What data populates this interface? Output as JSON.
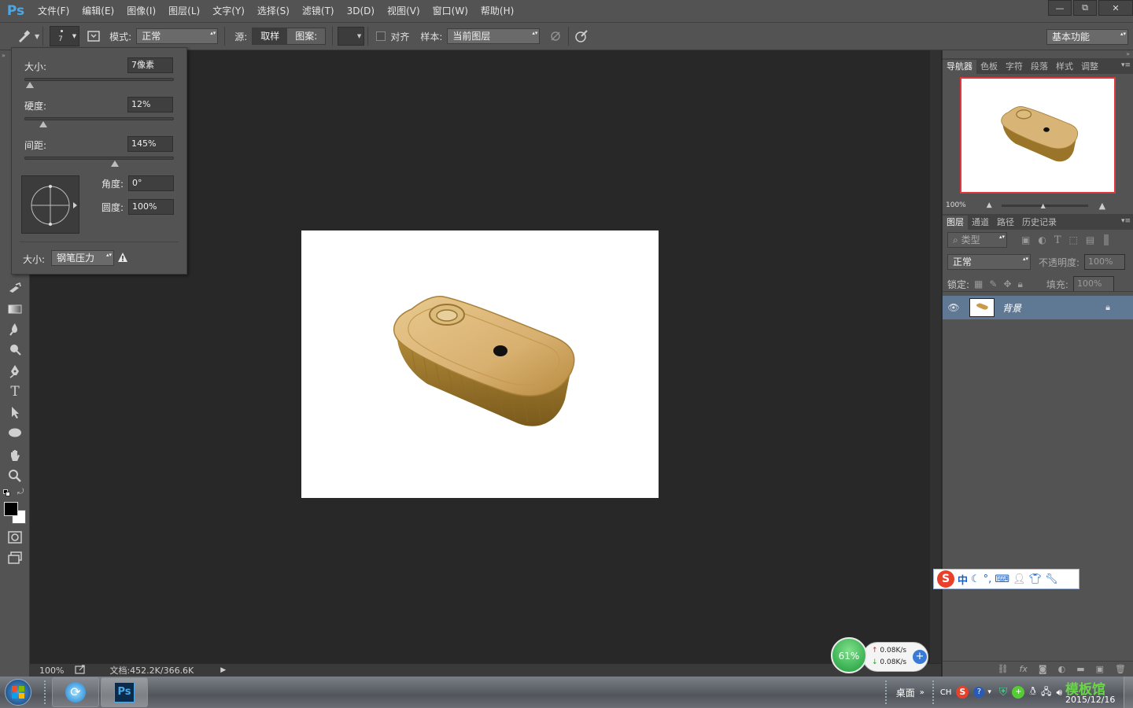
{
  "app": {
    "logo": "Ps"
  },
  "menu": [
    "文件(F)",
    "编辑(E)",
    "图像(I)",
    "图层(L)",
    "文字(Y)",
    "选择(S)",
    "滤镜(T)",
    "3D(D)",
    "视图(V)",
    "窗口(W)",
    "帮助(H)"
  ],
  "window_controls": {
    "minimize": "—",
    "restore": "⧉",
    "close": "✕"
  },
  "options": {
    "brush_size": "7",
    "mode_label": "模式:",
    "mode_value": "正常",
    "source_label": "源:",
    "source_sampled": "取样",
    "source_pattern": "图案:",
    "aligned_label": "对齐",
    "sample_label": "样本:",
    "sample_value": "当前图层",
    "workspace": "基本功能"
  },
  "brush_popup": {
    "size_label": "大小:",
    "size_value": "7像素",
    "hardness_label": "硬度:",
    "hardness_value": "12%",
    "spacing_label": "间距:",
    "spacing_value": "145%",
    "angle_label": "角度:",
    "angle_value": "0°",
    "roundness_label": "圆度:",
    "roundness_value": "100%",
    "pressure_label": "大小:",
    "pressure_value": "钢笔压力",
    "size_level": 0.03,
    "hardness_level": 0.12,
    "spacing_level": 0.6
  },
  "status": {
    "zoom": "100%",
    "doc": "文档:452.2K/366.6K"
  },
  "navigator": {
    "tabs": [
      "导航器",
      "色板",
      "字符",
      "段落",
      "样式",
      "调整"
    ],
    "zoom": "100%"
  },
  "layers": {
    "tabs": [
      "图层",
      "通道",
      "路径",
      "历史记录"
    ],
    "filter_kind": "类型",
    "blend_mode": "正常",
    "opacity_label": "不透明度:",
    "opacity_value": "100%",
    "lock_label": "锁定:",
    "fill_label": "填充:",
    "fill_value": "100%",
    "layer_name": "背景"
  },
  "ime": {
    "lang": "中"
  },
  "netspeed": {
    "percent": "61%",
    "up": "0.08K/s",
    "down": "0.08K/s"
  },
  "taskbar": {
    "desktop": "桌面",
    "lang": "CH",
    "date": "2015/12/16",
    "watermark": "模板馆"
  }
}
